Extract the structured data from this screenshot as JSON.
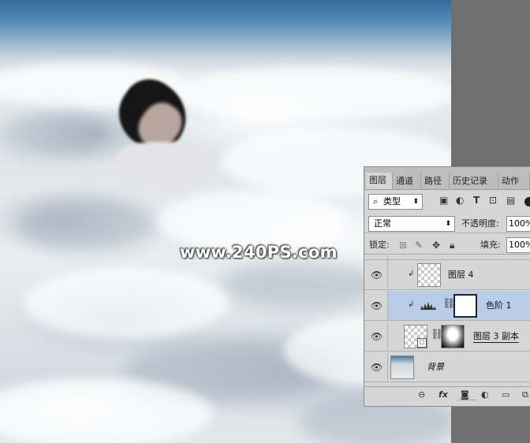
{
  "watermark": "www.240PS.com",
  "panel": {
    "tabs": [
      "图层",
      "通道",
      "路径",
      "历史记录",
      "动作"
    ],
    "filter": {
      "label": "类型"
    },
    "blend_mode": "正常",
    "opacity_label": "不透明度:",
    "opacity_value": "100%",
    "lock_label": "锁定:",
    "fill_label": "填充:",
    "fill_value": "100%",
    "layers": [
      {
        "name": "图层 4",
        "selected": false,
        "clipped": true,
        "visible": true
      },
      {
        "name": "色阶 1",
        "selected": true,
        "clipped": true,
        "visible": true
      },
      {
        "name": "图层 3 副本",
        "selected": false,
        "clipped": false,
        "visible": true
      },
      {
        "name": "背景",
        "selected": false,
        "clipped": false,
        "visible": true
      }
    ],
    "footer_icons": [
      "link-icon",
      "fx-icon",
      "mask-icon",
      "adjustment-icon",
      "folder-icon",
      "new-layer-icon"
    ]
  },
  "colors": {
    "selected_row": "#b9cde9",
    "panel_bg": "#d6d6d6",
    "canvas_gutter": "#6f6f6f"
  }
}
